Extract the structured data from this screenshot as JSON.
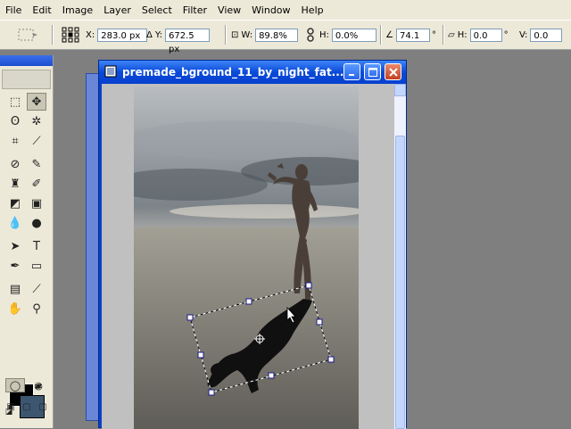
{
  "menu": [
    "File",
    "Edit",
    "Image",
    "Layer",
    "Select",
    "Filter",
    "View",
    "Window",
    "Help"
  ],
  "options": {
    "x_label": "X:",
    "x_value": "283.0 px",
    "y_label": "Y:",
    "y_value": "672.5 px",
    "w_label": "W:",
    "w_value": "89.8%",
    "h_label": "H:",
    "h_value": "0.0%",
    "angle_value": "74.1",
    "angle_unit": "°",
    "hskew_label": "H:",
    "hskew_value": "0.0",
    "hskew_unit": "°",
    "vskew_label": "V:",
    "vskew_value": "0.0",
    "vskew_unit": "°"
  },
  "document": {
    "title": "premade_bground_11_by_night_fat..."
  },
  "colors": {
    "foreground": "#000000",
    "background": "#3d5670",
    "titlebar": "#0a4ad8"
  }
}
